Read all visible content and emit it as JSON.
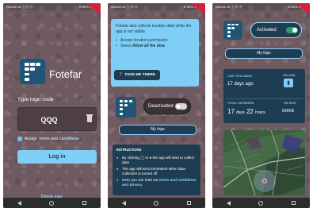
{
  "status": {
    "left": "Gionee x6 ⓘ ⓜ ⓦ",
    "right": "⊕ 86% 14:57"
  },
  "nav_icons": [
    "back-icon",
    "home-icon",
    "recents-icon"
  ],
  "brand": {
    "name": "Fotefar",
    "logo_icon": "fotefar-logo-icon",
    "color": "#1f5677"
  },
  "login": {
    "code_label": "Type login code",
    "code_value": "QQQ",
    "accept_prefix": "Accept",
    "terms_link": "terms and conditions",
    "login_button": "Log in",
    "delete_user": "Delete user"
  },
  "permission": {
    "info_text": "Fotefar also collects location data while the app is not visible.",
    "bullet1": "Accept location permission",
    "bullet2_prefix": "Select",
    "bullet2_bold": "Allow all the time",
    "take_button": "TAKE ME THERE"
  },
  "tracking_off": {
    "toggle_label": "Deactivated",
    "my_trips": "My trips",
    "instructions_title": "INSTRUCTIONS",
    "instructions": [
      "By clicking ◯ to ● the app will start to collect data",
      "The app will send reminders when data collection is turned off"
    ],
    "instr3_prefix": "Here you can read our",
    "instr3_link": "terms and conditions and privacy"
  },
  "tracking_on": {
    "toggle_label": "Activated",
    "my_trips": "My trips",
    "last_uploaded_label": "LAST UPLOADED",
    "last_uploaded_value": "17 days ago",
    "upload_label": "UPLOAD",
    "total_gathered_label": "TOTAL GATHERED",
    "total_days_num": "17",
    "total_days_unit": "days",
    "total_hours_num": "22",
    "total_hours_unit": "hours",
    "on_disk_label": "ON DISK",
    "on_disk_value": "600KB"
  },
  "colors": {
    "background": "#6e5a60",
    "accent": "#7fcef6",
    "panel": "#1e3d52",
    "ribbon": "#d4213b",
    "toggle_on": "#2f9e64"
  }
}
